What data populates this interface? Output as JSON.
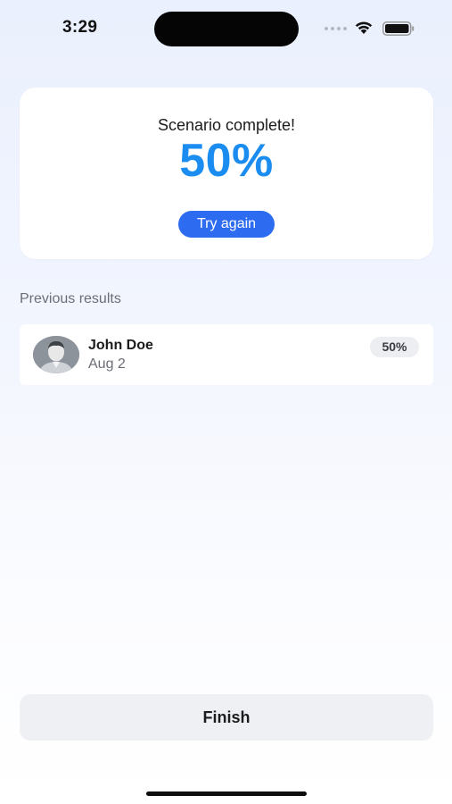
{
  "status_bar": {
    "time": "3:29",
    "icons": [
      "cellular-signal-icon",
      "wifi-icon",
      "battery-icon"
    ]
  },
  "result_card": {
    "title": "Scenario complete!",
    "score": "50%",
    "try_again_label": "Try again"
  },
  "previous_results": {
    "label": "Previous results",
    "items": [
      {
        "name": "John Doe",
        "date": "Aug 2",
        "score": "50%",
        "avatar_icon": "user-avatar"
      }
    ]
  },
  "footer": {
    "finish_label": "Finish"
  },
  "colors": {
    "accent_blue": "#2d6cf0",
    "score_blue": "#1b8df0",
    "background_top": "#eaf0fd",
    "card_background": "#ffffff",
    "muted_text": "#6b6e76"
  }
}
